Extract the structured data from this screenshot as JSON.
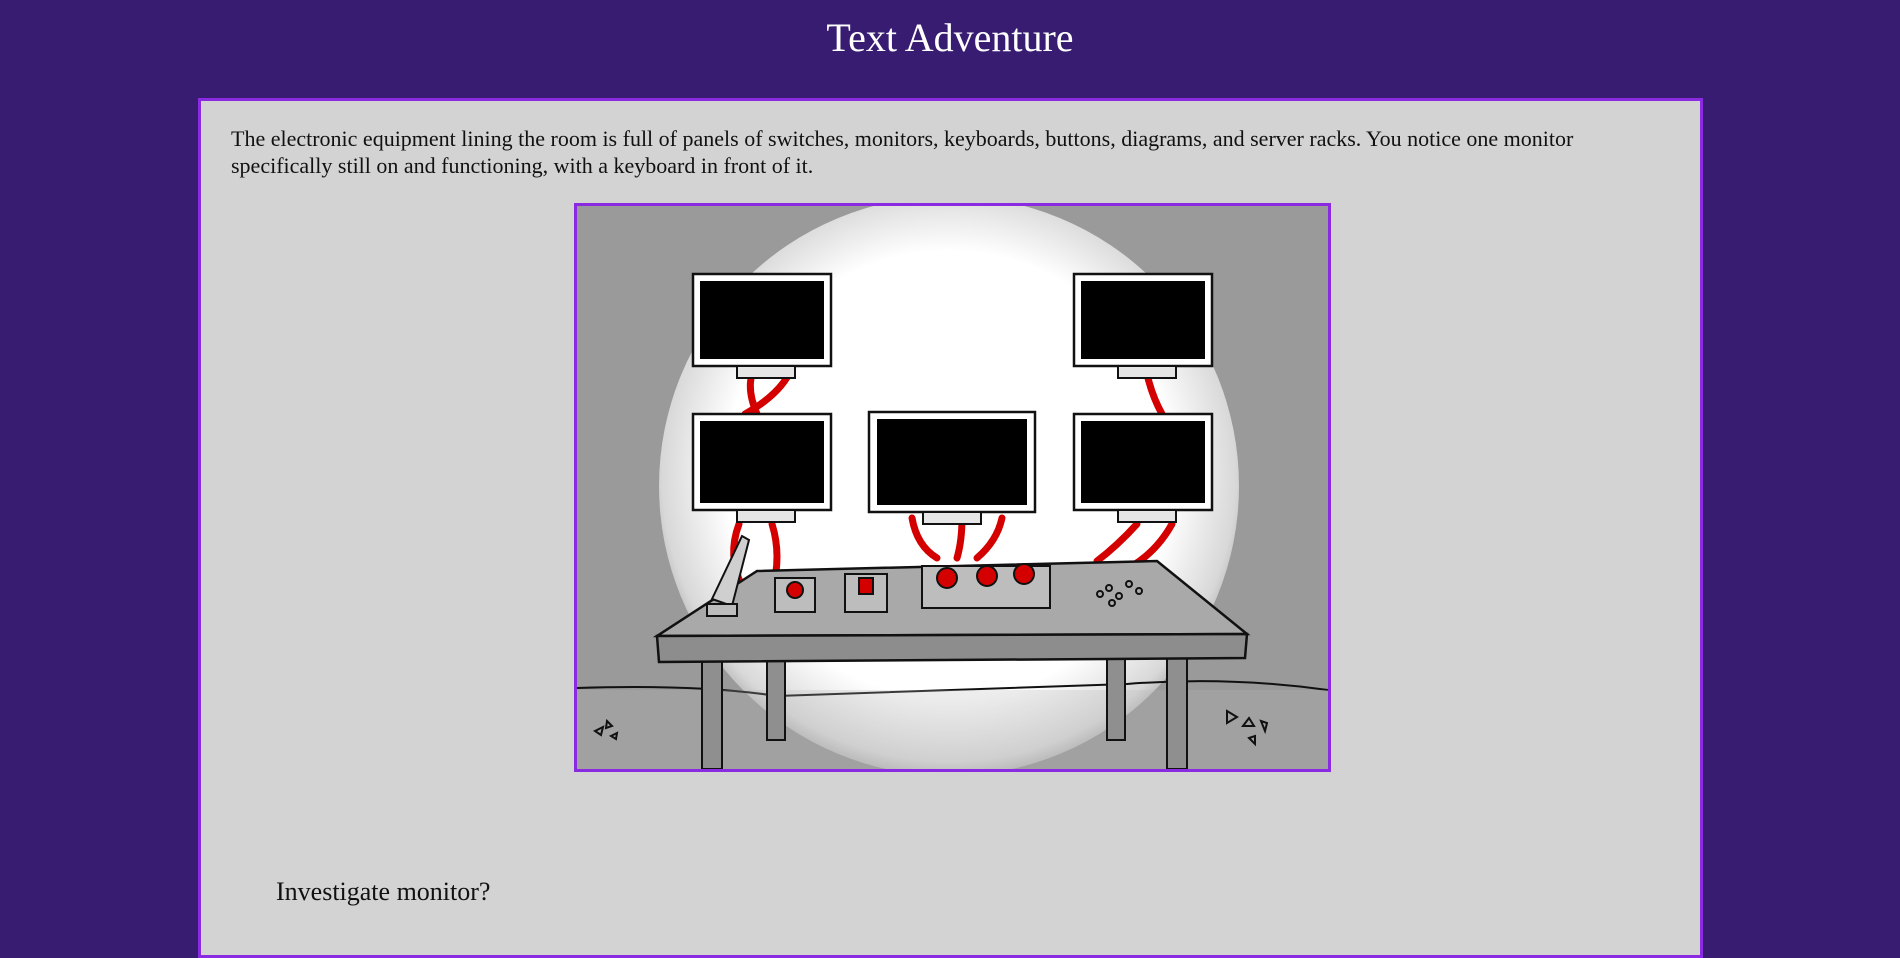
{
  "header": {
    "title": "Text Adventure"
  },
  "scene": {
    "description": "The electronic equipment lining the room is full of panels of switches, monitors, keyboards, buttons, diagrams, and server racks. You notice one monitor specifically still on and functioning, with a keyboard in front of it."
  },
  "choices": [
    {
      "label": "Investigate monitor?"
    }
  ],
  "colors": {
    "background": "#381c72",
    "panel": "#d3d3d3",
    "accent_border": "#8a2be2",
    "cable_red": "#d40000"
  }
}
